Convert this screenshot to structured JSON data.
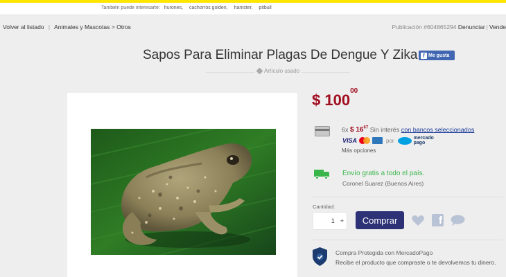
{
  "topbar": {
    "suggest_label": "También puede interesarte:",
    "suggestions": [
      "hurones,",
      "cachorros golden,",
      "hamster,",
      "pitbull"
    ]
  },
  "breadcrumb": {
    "back": "Volver al listado",
    "category": "Animales y Mascotas",
    "separator": ">",
    "subcategory": "Otros"
  },
  "publication": {
    "id_text": "Publicación #604865294",
    "report": "Denunciar",
    "seller": "Vende"
  },
  "listing": {
    "title": "Sapos Para Eliminar Plagas De Dengue Y Zika.",
    "fb_like": "Me gusta",
    "condition": "Artículo usado"
  },
  "price": {
    "currency": "$",
    "amount": "100",
    "cents": "00"
  },
  "installments": {
    "count": "6x",
    "amount": "$ 16",
    "cents": "67",
    "interest": "Sin interés",
    "banks_link": "con bancos seleccionados",
    "visa": "VISA",
    "por": "por",
    "mp_line1": "mercado",
    "mp_line2": "pago",
    "more_options": "Más opciones"
  },
  "shipping": {
    "text": "Envío gratis a todo el país.",
    "location": "Coronel Suarez (Buenos Aires)"
  },
  "purchase": {
    "quantity_label": "Cantidad:",
    "quantity": "1",
    "plus": "+",
    "buy_label": "Comprar",
    "fb_glyph": "f"
  },
  "protection": {
    "title": "Compra Protegida con MercadoPago",
    "description": "Recibe el producto que compraste o te devolvemos tu dinero."
  },
  "colors": {
    "price": "#a00d1e",
    "buy_button": "#2d3277",
    "shipping": "#39b54a",
    "link": "#1c3c99",
    "topbar_accent": "#ffe600"
  },
  "icons": [
    "tag-icon",
    "card-icon",
    "truck-icon",
    "heart-icon",
    "facebook-icon",
    "chat-icon",
    "shield-icon"
  ]
}
